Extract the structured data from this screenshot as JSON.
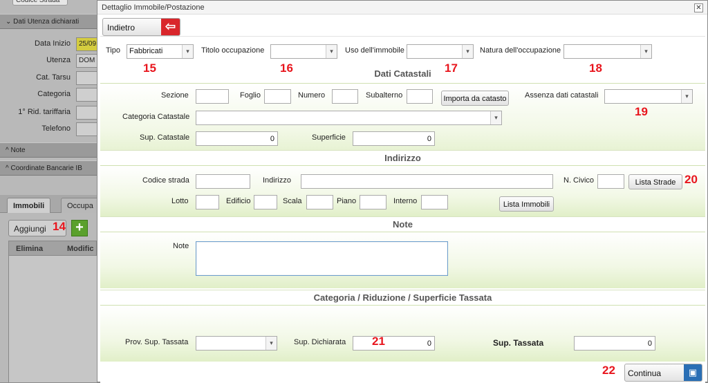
{
  "background": {
    "top_tab": "Codice Strada",
    "section_dati": "Dati Utenza dichiarati",
    "fields": [
      {
        "label": "Data Inizio",
        "value": "25/09"
      },
      {
        "label": "Utenza",
        "value": "DOM"
      },
      {
        "label": "Cat. Tarsu",
        "value": ""
      },
      {
        "label": "Categoria",
        "value": ""
      },
      {
        "label": "1° Rid. tariffaria",
        "value": ""
      },
      {
        "label": "Telefono",
        "value": ""
      }
    ],
    "section_note": "Note",
    "section_coordinate": "Coordinate Bancarie IB",
    "tabs": [
      "Immobili",
      "Occupa"
    ],
    "add_label": "Aggiungi",
    "table_headers": [
      "Elimina",
      "Modific"
    ]
  },
  "annotations": {
    "a14": "14",
    "a15": "15",
    "a16": "16",
    "a17": "17",
    "a18": "18",
    "a19": "19",
    "a20": "20",
    "a21": "21",
    "a22": "22"
  },
  "dialog": {
    "title": "Dettaglio Immobile/Postazione",
    "close": "✕",
    "back_label": "Indietro",
    "filters": {
      "tipo_label": "Tipo",
      "tipo_value": "Fabbricati",
      "titolo_label": "Titolo occupazione",
      "titolo_value": "",
      "uso_label": "Uso dell'immobile",
      "uso_value": "",
      "natura_label": "Natura dell'occupazione",
      "natura_value": ""
    },
    "catastali": {
      "header": "Dati Catastali",
      "sezione_label": "Sezione",
      "sezione_value": "",
      "foglio_label": "Foglio",
      "foglio_value": "",
      "numero_label": "Numero",
      "numero_value": "",
      "subalterno_label": "Subalterno",
      "subalterno_value": "",
      "importa_label": "Importa da catasto",
      "assenza_label": "Assenza dati catastali",
      "assenza_value": "",
      "categoria_label": "Categoria Catastale",
      "categoria_value": "",
      "sup_catastale_label": "Sup. Catastale",
      "sup_catastale_value": "0",
      "superficie_label": "Superficie",
      "superficie_value": "0"
    },
    "indirizzo": {
      "header": "Indirizzo",
      "codice_label": "Codice strada",
      "codice_value": "",
      "indirizzo_label": "Indirizzo",
      "indirizzo_value": "",
      "civico_label": "N. Civico",
      "civico_value": "",
      "lista_strade_label": "Lista Strade",
      "lotto_label": "Lotto",
      "lotto_value": "",
      "edificio_label": "Edificio",
      "edificio_value": "",
      "scala_label": "Scala",
      "scala_value": "",
      "piano_label": "Piano",
      "piano_value": "",
      "interno_label": "Interno",
      "interno_value": "",
      "lista_immobili_label": "Lista Immobili"
    },
    "note": {
      "header": "Note",
      "note_label": "Note",
      "note_value": ""
    },
    "tassata": {
      "header": "Categoria / Riduzione / Superficie Tassata",
      "prov_label": "Prov. Sup. Tassata",
      "prov_value": "",
      "dichiarata_label": "Sup. Dichiarata",
      "dichiarata_value": "0",
      "tassata_label": "Sup. Tassata",
      "tassata_value": "0"
    },
    "continua_label": "Continua"
  }
}
